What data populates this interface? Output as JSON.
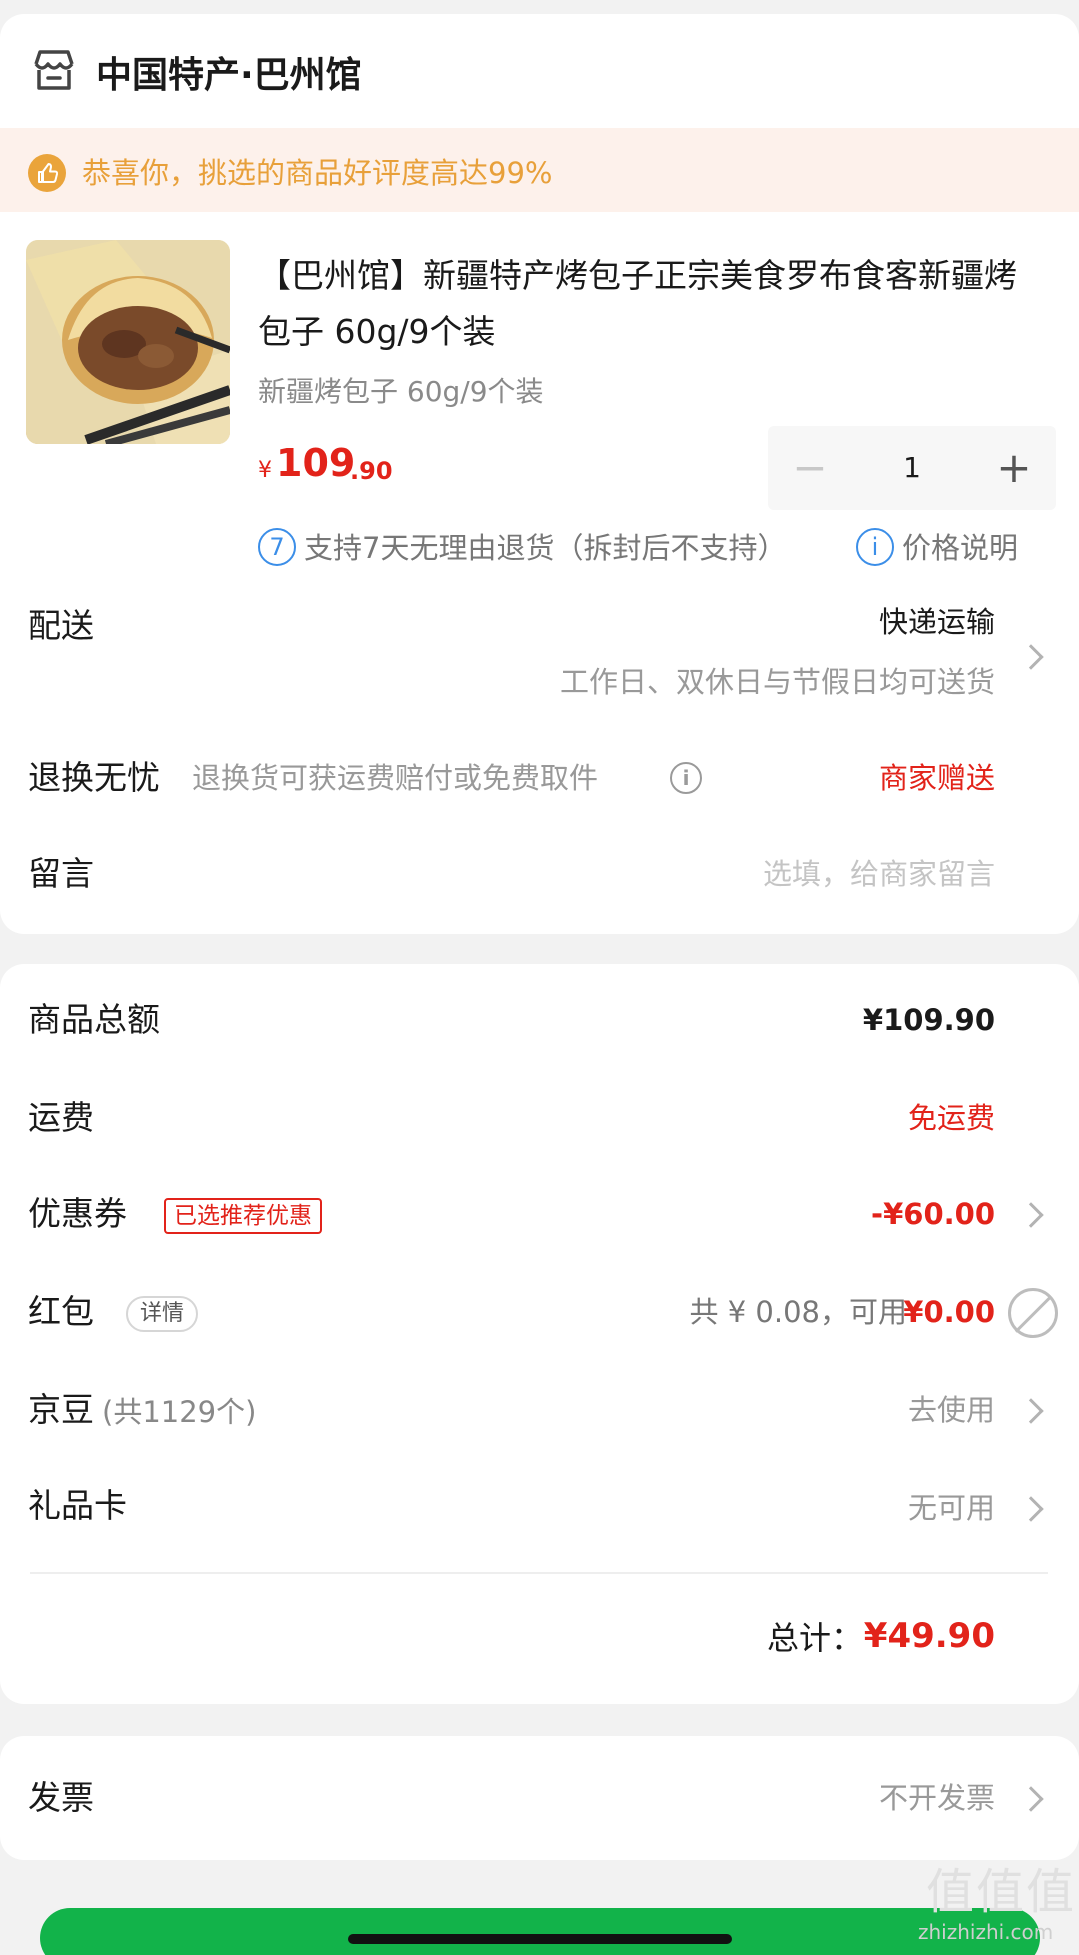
{
  "store": {
    "icon": "store-icon",
    "name": "中国特产·巴州馆"
  },
  "praise": {
    "icon": "thumbs-up-icon",
    "text": "恭喜你，挑选的商品好评度高达99%"
  },
  "product": {
    "image": "product-thumbnail",
    "title": "【巴州馆】新疆特产烤包子正宗美食罗布食客新疆烤包子 60g/9个装",
    "spec": "新疆烤包子 60g/9个装",
    "price_symbol": "¥",
    "price_int": "109",
    "price_dec": ".90",
    "quantity": "1",
    "minus_label": "−",
    "plus_label": "+",
    "return_badge": "7",
    "return_text": "支持7天无理由退货（拆封后不支持）",
    "price_info_badge": "i",
    "price_info_text": "价格说明"
  },
  "delivery": {
    "label": "配送",
    "method": "快递运输",
    "note": "工作日、双休日与节假日均可送货"
  },
  "return_worry_free": {
    "label": "退换无忧",
    "desc": "退换货可获运费赔付或免费取件",
    "info_badge": "i",
    "value": "商家赠送"
  },
  "message": {
    "label": "留言",
    "placeholder": "选填，给商家留言"
  },
  "summary": {
    "goods_total_label": "商品总额",
    "goods_total_value": "¥109.90",
    "shipping_label": "运费",
    "shipping_value": "免运费",
    "coupon_label": "优惠券",
    "coupon_tag": "已选推荐优惠",
    "coupon_value": "-¥60.00",
    "redpacket_label": "红包",
    "redpacket_tag": "详情",
    "redpacket_available": "共 ¥ 0.08，可用",
    "redpacket_value": "¥0.00",
    "jingdou_label": "京豆",
    "jingdou_count": "(共1129个)",
    "jingdou_value": "去使用",
    "giftcard_label": "礼品卡",
    "giftcard_value": "无可用",
    "total_label": "总计：",
    "total_value": "¥49.90"
  },
  "invoice": {
    "label": "发票",
    "value": "不开发票"
  },
  "watermark": {
    "glyphs": "值值值",
    "text": "zhizhizhi.com"
  },
  "colors": {
    "accent_red": "#e2231a",
    "praise_orange": "#e8a03a",
    "info_blue": "#3b8ee8",
    "green": "#12b34a"
  }
}
